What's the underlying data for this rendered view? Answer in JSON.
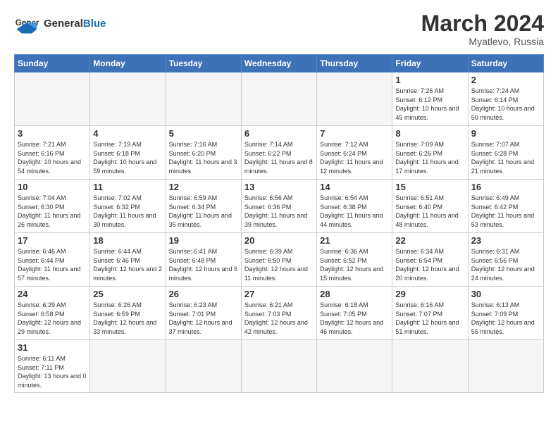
{
  "header": {
    "logo": {
      "general": "General",
      "blue": "Blue"
    },
    "title": "March 2024",
    "subtitle": "Myatlevo, Russia"
  },
  "weekdays": [
    "Sunday",
    "Monday",
    "Tuesday",
    "Wednesday",
    "Thursday",
    "Friday",
    "Saturday"
  ],
  "weeks": [
    [
      {
        "day": "",
        "info": ""
      },
      {
        "day": "",
        "info": ""
      },
      {
        "day": "",
        "info": ""
      },
      {
        "day": "",
        "info": ""
      },
      {
        "day": "",
        "info": ""
      },
      {
        "day": "1",
        "info": "Sunrise: 7:26 AM\nSunset: 6:12 PM\nDaylight: 10 hours and 45 minutes."
      },
      {
        "day": "2",
        "info": "Sunrise: 7:24 AM\nSunset: 6:14 PM\nDaylight: 10 hours and 50 minutes."
      }
    ],
    [
      {
        "day": "3",
        "info": "Sunrise: 7:21 AM\nSunset: 6:16 PM\nDaylight: 10 hours and 54 minutes."
      },
      {
        "day": "4",
        "info": "Sunrise: 7:19 AM\nSunset: 6:18 PM\nDaylight: 10 hours and 59 minutes."
      },
      {
        "day": "5",
        "info": "Sunrise: 7:16 AM\nSunset: 6:20 PM\nDaylight: 11 hours and 3 minutes."
      },
      {
        "day": "6",
        "info": "Sunrise: 7:14 AM\nSunset: 6:22 PM\nDaylight: 11 hours and 8 minutes."
      },
      {
        "day": "7",
        "info": "Sunrise: 7:12 AM\nSunset: 6:24 PM\nDaylight: 11 hours and 12 minutes."
      },
      {
        "day": "8",
        "info": "Sunrise: 7:09 AM\nSunset: 6:26 PM\nDaylight: 11 hours and 17 minutes."
      },
      {
        "day": "9",
        "info": "Sunrise: 7:07 AM\nSunset: 6:28 PM\nDaylight: 11 hours and 21 minutes."
      }
    ],
    [
      {
        "day": "10",
        "info": "Sunrise: 7:04 AM\nSunset: 6:30 PM\nDaylight: 11 hours and 26 minutes."
      },
      {
        "day": "11",
        "info": "Sunrise: 7:02 AM\nSunset: 6:32 PM\nDaylight: 11 hours and 30 minutes."
      },
      {
        "day": "12",
        "info": "Sunrise: 6:59 AM\nSunset: 6:34 PM\nDaylight: 11 hours and 35 minutes."
      },
      {
        "day": "13",
        "info": "Sunrise: 6:56 AM\nSunset: 6:36 PM\nDaylight: 11 hours and 39 minutes."
      },
      {
        "day": "14",
        "info": "Sunrise: 6:54 AM\nSunset: 6:38 PM\nDaylight: 11 hours and 44 minutes."
      },
      {
        "day": "15",
        "info": "Sunrise: 6:51 AM\nSunset: 6:40 PM\nDaylight: 11 hours and 48 minutes."
      },
      {
        "day": "16",
        "info": "Sunrise: 6:49 AM\nSunset: 6:42 PM\nDaylight: 11 hours and 53 minutes."
      }
    ],
    [
      {
        "day": "17",
        "info": "Sunrise: 6:46 AM\nSunset: 6:44 PM\nDaylight: 11 hours and 57 minutes."
      },
      {
        "day": "18",
        "info": "Sunrise: 6:44 AM\nSunset: 6:46 PM\nDaylight: 12 hours and 2 minutes."
      },
      {
        "day": "19",
        "info": "Sunrise: 6:41 AM\nSunset: 6:48 PM\nDaylight: 12 hours and 6 minutes."
      },
      {
        "day": "20",
        "info": "Sunrise: 6:39 AM\nSunset: 6:50 PM\nDaylight: 12 hours and 11 minutes."
      },
      {
        "day": "21",
        "info": "Sunrise: 6:36 AM\nSunset: 6:52 PM\nDaylight: 12 hours and 15 minutes."
      },
      {
        "day": "22",
        "info": "Sunrise: 6:34 AM\nSunset: 6:54 PM\nDaylight: 12 hours and 20 minutes."
      },
      {
        "day": "23",
        "info": "Sunrise: 6:31 AM\nSunset: 6:56 PM\nDaylight: 12 hours and 24 minutes."
      }
    ],
    [
      {
        "day": "24",
        "info": "Sunrise: 6:29 AM\nSunset: 6:58 PM\nDaylight: 12 hours and 29 minutes."
      },
      {
        "day": "25",
        "info": "Sunrise: 6:26 AM\nSunset: 6:59 PM\nDaylight: 12 hours and 33 minutes."
      },
      {
        "day": "26",
        "info": "Sunrise: 6:23 AM\nSunset: 7:01 PM\nDaylight: 12 hours and 37 minutes."
      },
      {
        "day": "27",
        "info": "Sunrise: 6:21 AM\nSunset: 7:03 PM\nDaylight: 12 hours and 42 minutes."
      },
      {
        "day": "28",
        "info": "Sunrise: 6:18 AM\nSunset: 7:05 PM\nDaylight: 12 hours and 46 minutes."
      },
      {
        "day": "29",
        "info": "Sunrise: 6:16 AM\nSunset: 7:07 PM\nDaylight: 12 hours and 51 minutes."
      },
      {
        "day": "30",
        "info": "Sunrise: 6:13 AM\nSunset: 7:09 PM\nDaylight: 12 hours and 55 minutes."
      }
    ],
    [
      {
        "day": "31",
        "info": "Sunrise: 6:11 AM\nSunset: 7:11 PM\nDaylight: 13 hours and 0 minutes."
      },
      {
        "day": "",
        "info": ""
      },
      {
        "day": "",
        "info": ""
      },
      {
        "day": "",
        "info": ""
      },
      {
        "day": "",
        "info": ""
      },
      {
        "day": "",
        "info": ""
      },
      {
        "day": "",
        "info": ""
      }
    ]
  ]
}
